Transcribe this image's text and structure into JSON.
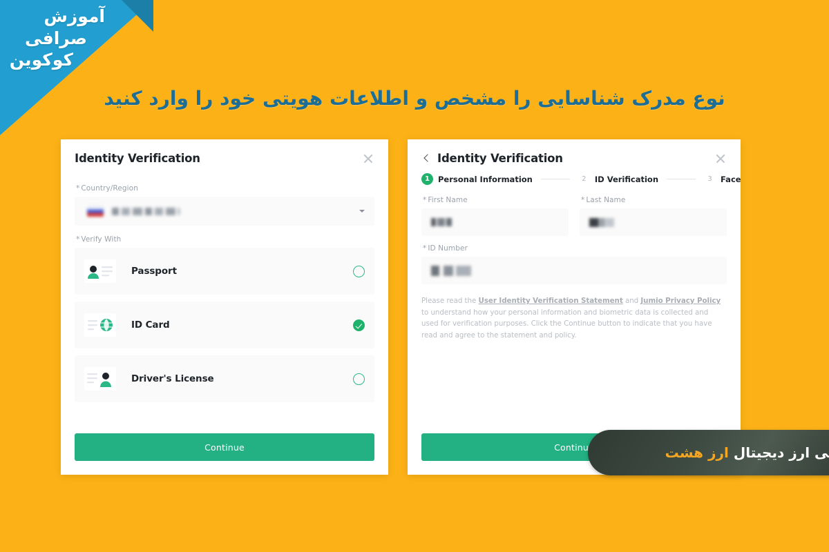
{
  "page": {
    "background_color": "#FCB116",
    "headline": "نوع مدرک شناسایی را مشخص و اطلاعات هویتی خود را وارد کنید"
  },
  "ribbon": {
    "color": "#229FD0",
    "fold_color": "#1C7FA8",
    "line1": "آموزش",
    "line2": "صرافی",
    "line3": "کوکوین"
  },
  "left_card": {
    "title": "Identity Verification",
    "close_label": "×",
    "country_field": {
      "label": "Country/Region",
      "required_mark": "*",
      "value": "",
      "redacted": true
    },
    "verify_with": {
      "label": "Verify With",
      "required_mark": "*",
      "options": [
        {
          "label": "Passport",
          "selected": false,
          "icon": "passport-icon"
        },
        {
          "label": "ID Card",
          "selected": true,
          "icon": "id-card-icon"
        },
        {
          "label": "Driver's License",
          "selected": false,
          "icon": "drivers-license-icon"
        }
      ]
    },
    "continue_label": "Continue"
  },
  "right_card": {
    "title": "Identity Verification",
    "back_label": "‹",
    "close_label": "×",
    "steps": [
      {
        "number": "1",
        "label": "Personal Information",
        "active": true
      },
      {
        "number": "2",
        "label": "ID Verification",
        "active": false
      },
      {
        "number": "3",
        "label": "Face Verification",
        "active": false
      }
    ],
    "fields": {
      "first_name": {
        "label": "First Name",
        "required_mark": "*",
        "value": "",
        "redacted": true
      },
      "last_name": {
        "label": "Last Name",
        "required_mark": "*",
        "value": "",
        "redacted": true
      },
      "id_number": {
        "label": "ID Number",
        "required_mark": "*",
        "value": "",
        "redacted": true
      }
    },
    "legal": {
      "part1": "Please read the ",
      "link1": "User Identity Verification Statement",
      "part2": " and ",
      "link2": "Jumio Privacy Policy",
      "part3": " to understand how your personal information and biometric data is collected and used for verification purposes. Click the Continue button to indicate that you have read and agree to the statement and policy."
    },
    "continue_label": "Continue"
  },
  "watermark": {
    "text_main": "صرافی ارز دیجیتال ",
    "text_accent": "ارز هشت",
    "accent_color": "#F5A623"
  },
  "colors": {
    "green_accent": "#23B183",
    "green_check": "#20B26C",
    "headline_blue": "#1D6E96",
    "card_bg": "#FFFFFF",
    "field_bg": "#FAFAFA"
  }
}
